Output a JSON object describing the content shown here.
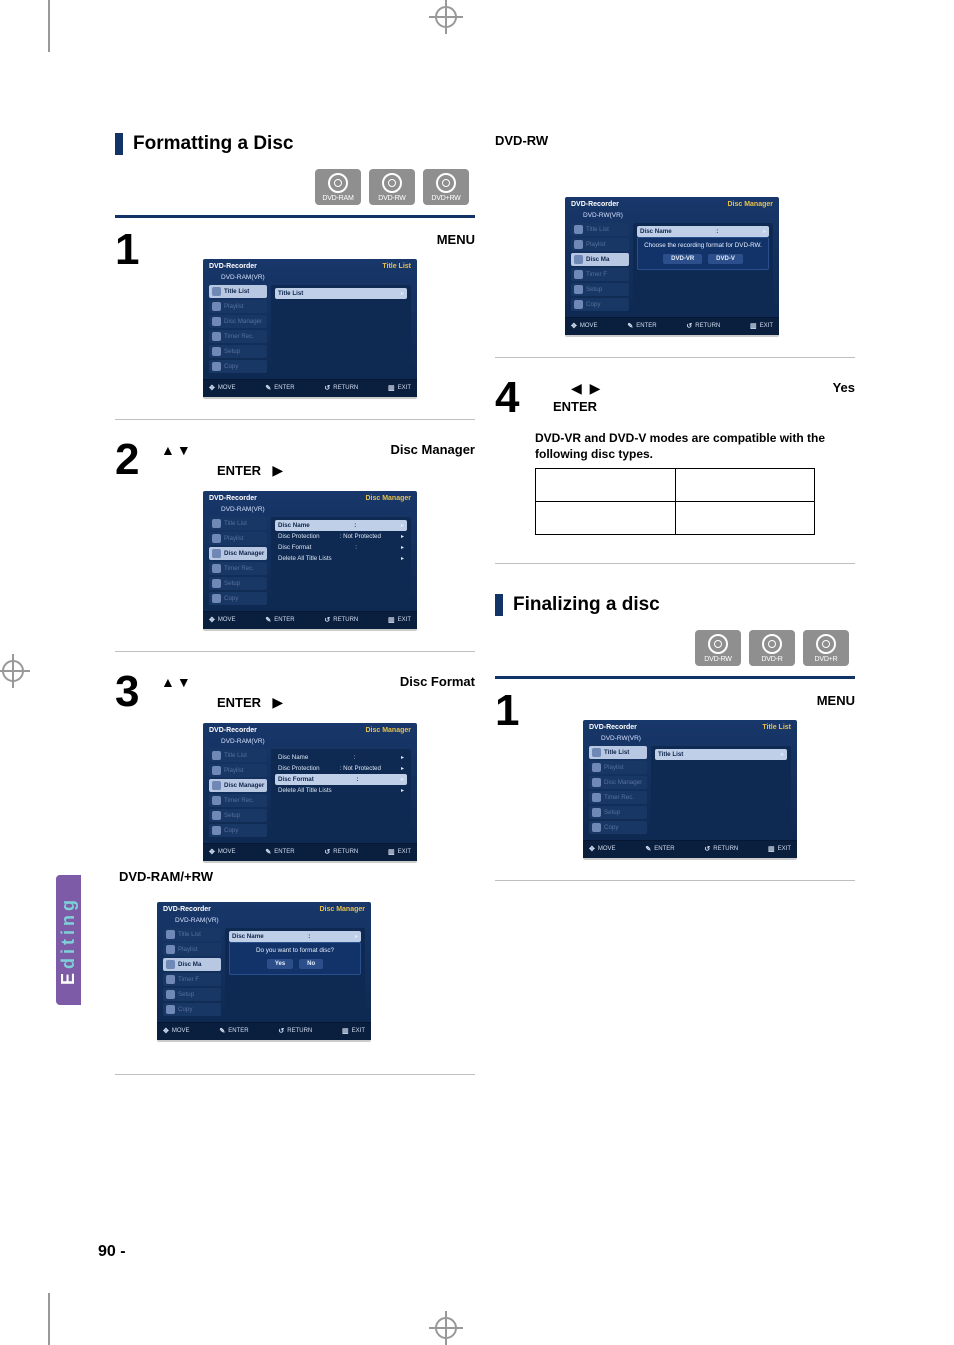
{
  "headings": {
    "formatting": "Formatting a Disc",
    "finalizing": "Finalizing a disc"
  },
  "disc_labels": {
    "dvd_ram": "DVD-RAM",
    "dvd_rw": "DVD-RW",
    "dvd_plus_rw": "DVD+RW",
    "dvd_r": "DVD-R",
    "dvd_plus_r": "DVD+R"
  },
  "right_header": "DVD-RW",
  "mid_label_left": "DVD-RAM/+RW",
  "steps": {
    "menu_word": "MENU",
    "enter_word": "ENTER",
    "arrows_ud": "▲▼",
    "arrows_lr": "◀ ▶",
    "play_tri": "▶",
    "disc_manager": "Disc Manager",
    "disc_format": "Disc Format",
    "yes": "Yes"
  },
  "note_compat": "DVD-VR and DVD-V modes are compatible with the following disc types.",
  "screen_common": {
    "recorder": "DVD-Recorder",
    "hint_move": "MOVE",
    "hint_enter": "ENTER",
    "hint_return": "RETURN",
    "hint_exit": "EXIT",
    "sym_move": "✥",
    "sym_enter": "✎",
    "sym_return": "↺",
    "sym_exit": "▥"
  },
  "screen1": {
    "header_right": "Title List",
    "subtitle": "DVD-RAM(VR)",
    "sidebar": [
      "Title List",
      "Playlist",
      "Disc Manager",
      "Timer Rec.",
      "Setup",
      "Copy"
    ],
    "selected": 0,
    "pane_rows": [
      [
        "Title List",
        ""
      ]
    ]
  },
  "screen2": {
    "header_right": "Disc Manager",
    "subtitle": "DVD-RAM(VR)",
    "sidebar": [
      "Title List",
      "Playlist",
      "Disc Manager",
      "Timer Rec.",
      "Setup",
      "Copy"
    ],
    "selected": 2,
    "pane_rows": [
      [
        "Disc Name",
        ":"
      ],
      [
        "Disc Protection",
        ": Not Protected"
      ],
      [
        "Disc Format",
        ":"
      ],
      [
        "Delete All Title Lists",
        ""
      ]
    ],
    "pane_selected": 0
  },
  "screen3": {
    "header_right": "Disc Manager",
    "subtitle": "DVD-RAM(VR)",
    "sidebar": [
      "Title List",
      "Playlist",
      "Disc Manager",
      "Timer Rec.",
      "Setup",
      "Copy"
    ],
    "selected": 2,
    "pane_rows": [
      [
        "Disc Name",
        ":"
      ],
      [
        "Disc Protection",
        ": Not Protected"
      ],
      [
        "Disc Format",
        ":"
      ],
      [
        "Delete All Title Lists",
        ""
      ]
    ],
    "pane_selected": 2
  },
  "screen4": {
    "header_right": "Disc Manager",
    "subtitle": "DVD-RAM(VR)",
    "sidebar": [
      "Title List",
      "Playlist",
      "Disc Ma",
      "Timer F",
      "Setup",
      "Copy"
    ],
    "selected": 2,
    "dialog_text": "Do you want to format disc?",
    "dialog_buttons": [
      "Yes",
      "No"
    ]
  },
  "screen5": {
    "header_right": "Disc Manager",
    "subtitle": "DVD-RW(VR)",
    "sidebar": [
      "Title List",
      "Playlist",
      "Disc Ma",
      "Timer F",
      "Setup",
      "Copy"
    ],
    "selected": 2,
    "pane_rows": [
      [
        "Disc Name",
        ":"
      ]
    ],
    "dialog_text": "Choose the recording format for DVD-RW.",
    "dialog_buttons": [
      "DVD-VR",
      "DVD-V"
    ]
  },
  "screen6": {
    "header_right": "Title List",
    "subtitle": "DVD-RW(VR)",
    "sidebar": [
      "Title List",
      "Playlist",
      "Disc Manager",
      "Timer Rec.",
      "Setup",
      "Copy"
    ],
    "selected": 0,
    "pane_rows": [
      [
        "Title List",
        ""
      ]
    ]
  },
  "editing_tab": {
    "bold": "E",
    "rest": "diting"
  },
  "page_number": "90 -"
}
